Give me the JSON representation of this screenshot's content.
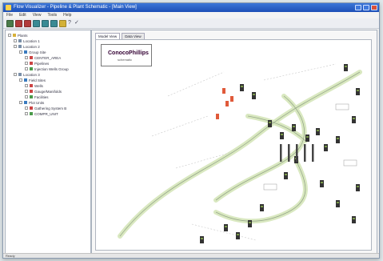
{
  "window": {
    "title": "Flow Visualizer - Pipeline & Plant Schematic - [Main View]"
  },
  "menu": [
    "File",
    "Edit",
    "View",
    "Tools",
    "Help"
  ],
  "toolbar": {
    "buttons": [
      {
        "name": "open-button",
        "color": "#4a7b4a"
      },
      {
        "name": "save-button",
        "color": "#b23b3b"
      },
      {
        "name": "print-button",
        "color": "#b23b3b"
      },
      {
        "name": "layers-button",
        "color": "#3a8a94"
      },
      {
        "name": "refresh-button",
        "color": "#3a8a94"
      },
      {
        "name": "zoom-button",
        "color": "#3a8a94"
      },
      {
        "name": "highlight-button",
        "color": "#d4b136"
      }
    ],
    "extras": [
      "?",
      "✓"
    ]
  },
  "tree": [
    {
      "label": "Plants",
      "depth": 0,
      "color": "#d8b13a"
    },
    {
      "label": "Location 1",
      "depth": 1,
      "color": "#7a8fa8"
    },
    {
      "label": "Location 2",
      "depth": 1,
      "color": "#7a8fa8"
    },
    {
      "label": "Group Site",
      "depth": 2,
      "color": "#3a7bbf"
    },
    {
      "label": "CENTER_AREA",
      "depth": 3,
      "color": "#c44"
    },
    {
      "label": "Pipelines",
      "depth": 3,
      "color": "#c44"
    },
    {
      "label": "Injection Wells Group",
      "depth": 3,
      "color": "#4a9a4a"
    },
    {
      "label": "Location 3",
      "depth": 1,
      "color": "#7a8fa8"
    },
    {
      "label": "Field Sites",
      "depth": 2,
      "color": "#3a7bbf"
    },
    {
      "label": "Wells",
      "depth": 3,
      "color": "#c44"
    },
    {
      "label": "Gauge/Manifolds",
      "depth": 3,
      "color": "#c44"
    },
    {
      "label": "Facilities",
      "depth": 3,
      "color": "#4a9a4a"
    },
    {
      "label": "Plot Units",
      "depth": 2,
      "color": "#3a7bbf"
    },
    {
      "label": "Gathering System B",
      "depth": 3,
      "color": "#c44"
    },
    {
      "label": "COMPR_UNIT",
      "depth": 3,
      "color": "#4a9a4a"
    }
  ],
  "tabs": [
    {
      "label": "Model View"
    },
    {
      "label": "Data View"
    }
  ],
  "logo": {
    "brand": "ConocoPhillips",
    "sub": "schematic"
  },
  "status": {
    "text": "Ready"
  }
}
